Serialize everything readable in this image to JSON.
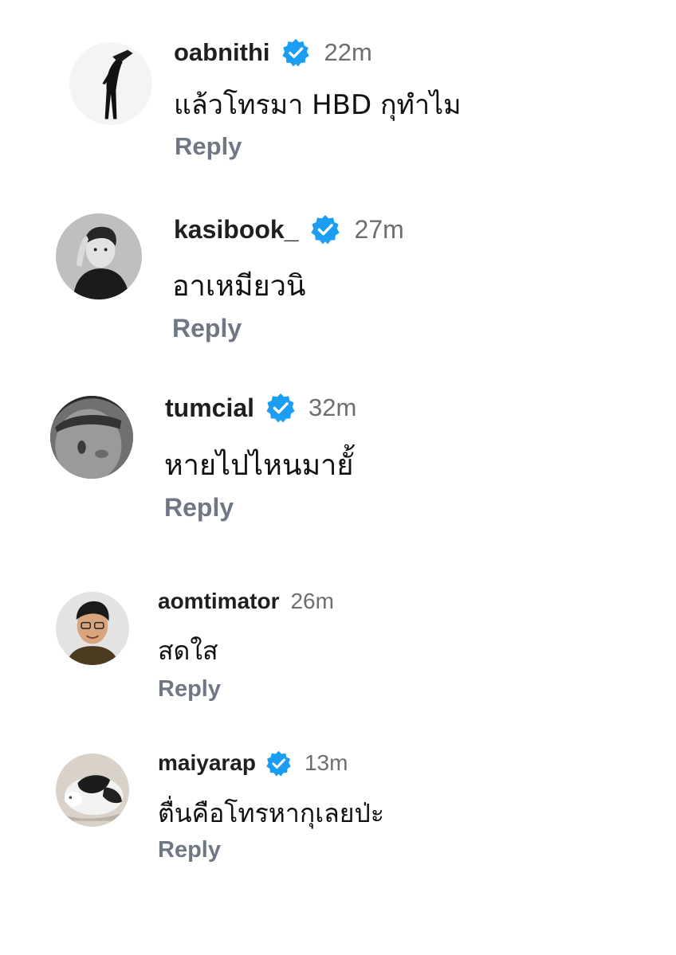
{
  "comments": [
    {
      "username": "oabnithi",
      "verified": true,
      "time": "22m",
      "text": "แล้วโทรมา HBD กุทำไม",
      "reply_label": "Reply",
      "avatar": "man-in-black-suit-bowing"
    },
    {
      "username": "kasibook_",
      "verified": true,
      "time": "27m",
      "text": "อาเหมียวนิ",
      "reply_label": "Reply",
      "avatar": "man-portrait-bw"
    },
    {
      "username": "tumcial",
      "verified": true,
      "time": "32m",
      "text": "หายไปไหนมายั้",
      "reply_label": "Reply",
      "avatar": "face-closeup-bw"
    },
    {
      "username": "aomtimator",
      "verified": false,
      "time": "26m",
      "text": "สดใส",
      "reply_label": "Reply",
      "avatar": "man-glasses-smiling"
    },
    {
      "username": "maiyarap",
      "verified": true,
      "time": "13m",
      "text": "ตื่นคือโทรหากุเลยป่ะ",
      "reply_label": "Reply",
      "avatar": "black-white-cat"
    }
  ],
  "colors": {
    "verified_badge": "#1a9df2",
    "reply": "#707784",
    "time": "#6e6e6e"
  }
}
